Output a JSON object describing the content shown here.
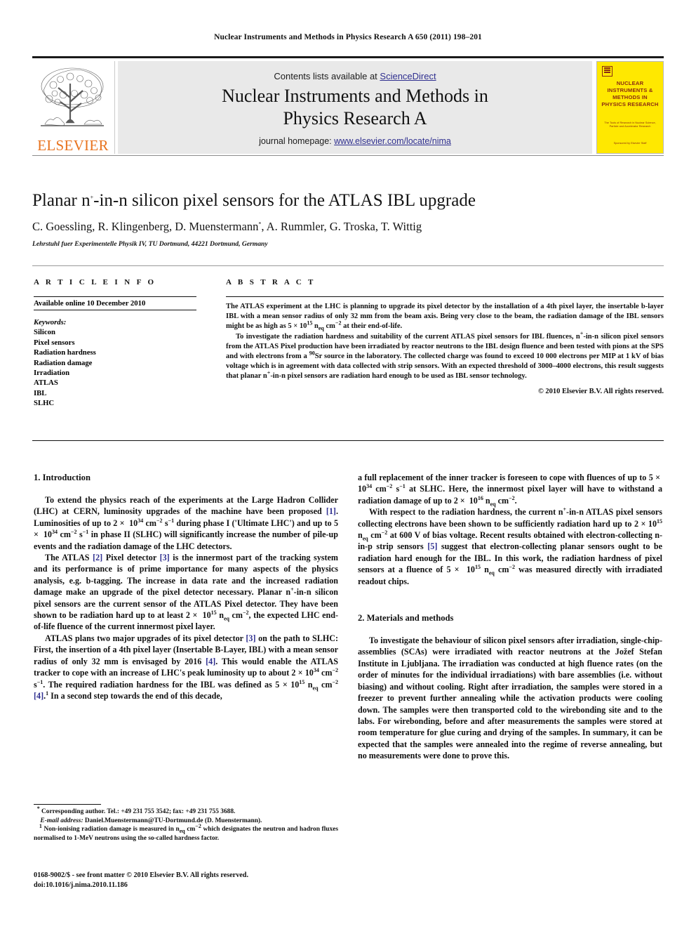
{
  "running_head": "Nuclear Instruments and Methods in Physics Research A 650 (2011) 198–201",
  "masthead": {
    "publisher_name": "ELSEVIER",
    "contents_prefix": "Contents lists available at ",
    "contents_link": "ScienceDirect",
    "journal_title_line1": "Nuclear Instruments and Methods in",
    "journal_title_line2": "Physics Research A",
    "homepage_prefix": "journal homepage: ",
    "homepage_link": "www.elsevier.com/locate/nima",
    "cover": {
      "title": "NUCLEAR INSTRUMENTS & METHODS IN PHYSICS RESEARCH",
      "subtitle": "The Tools of Research in Nuclear Science, Particle and Accelerator Research",
      "footer": "Sponsored by Elsevier Staff"
    },
    "colors": {
      "link": "#2f2f8f",
      "elsevier_orange": "#E8731E",
      "cover_yellow": "#FFE800",
      "cover_text": "#8a2a12",
      "masthead_grey": "#e9e9e9"
    }
  },
  "article": {
    "title": "Planar n+-in-n silicon pixel sensors for the ATLAS IBL upgrade",
    "authors": "C. Goessling, R. Klingenberg, D. Muenstermann *, A. Rummler, G. Troska, T. Wittig",
    "affiliation": "Lehrstuhl fuer Experimentelle Physik IV, TU Dortmund, 44221 Dortmund, Germany"
  },
  "article_info": {
    "heading": "A R T I C L E   I N F O",
    "available_online": "Available online 10 December 2010",
    "keywords_label": "Keywords:",
    "keywords": [
      "Silicon",
      "Pixel sensors",
      "Radiation hardness",
      "Radiation damage",
      "Irradiation",
      "ATLAS",
      "IBL",
      "SLHC"
    ]
  },
  "abstract": {
    "heading": "A B S T R A C T",
    "paragraph1": "The ATLAS experiment at the LHC is planning to upgrade its pixel detector by the installation of a 4th pixel layer, the insertable b-layer IBL with a mean sensor radius of only 32 mm from the beam axis. Being very close to the beam, the radiation damage of the IBL sensors might be as high as 5 × 10^15 neq cm^-2 at their end-of-life.",
    "paragraph2": "To investigate the radiation hardness and suitability of the current ATLAS pixel sensors for IBL fluences, n+-in-n silicon pixel sensors from the ATLAS Pixel production have been irradiated by reactor neutrons to the IBL design fluence and been tested with pions at the SPS and with electrons from a 90Sr source in the laboratory. The collected charge was found to exceed 10 000 electrons per MIP at 1 kV of bias voltage which is in agreement with data collected with strip sensors. With an expected threshold of 3000–4000 electrons, this result suggests that planar n+-in-n pixel sensors are radiation hard enough to be used as IBL sensor technology.",
    "copyright": "© 2010 Elsevier B.V. All rights reserved."
  },
  "sections": {
    "introduction_heading": "1.  Introduction",
    "materials_heading": "2.  Materials and methods"
  },
  "body_left": {
    "p1_a": "To extend the physics reach of the experiments at the Large Hadron Collider (LHC) at CERN, luminosity upgrades of the machine have been proposed ",
    "p1_ref1": "[1]",
    "p1_b": ". Luminosities of up to 2 × 10^34 cm^-2 s^-1 during phase I ('Ultimate LHC') and up to 5 × 10^34 cm^-2 s^-1 in phase II (SLHC) will significantly increase the number of pile-up events and the radiation damage of the LHC detectors.",
    "p2_a": "The ATLAS ",
    "p2_ref1": "[2]",
    "p2_b": " Pixel detector ",
    "p2_ref2": "[3]",
    "p2_c": " is the innermost part of the tracking system and its performance is of prime importance for many aspects of the physics analysis, e.g. b-tagging. The increase in data rate and the increased radiation damage make an upgrade of the pixel detector necessary. Planar n+-in-n silicon pixel sensors are the current sensor of the ATLAS Pixel detector. They have been shown to be radiation hard up to at least 2 × 10^15 neq cm^-2, the expected LHC end-of-life fluence of the current innermost pixel layer.",
    "p3_a": "ATLAS plans two major upgrades of its pixel detector ",
    "p3_ref1": "[3]",
    "p3_b": " on the path to SLHC: First, the insertion of a 4th pixel layer (Insertable B-Layer, IBL) with a mean sensor radius of only 32 mm is envisaged by 2016 ",
    "p3_ref2": "[4]",
    "p3_c": ". This would enable the ATLAS tracker to cope with an increase of LHC's peak luminosity up to about 2 × 10^34 cm^-2 s^-1. The required radiation hardness for the IBL was defined as 5 × 10^15 neq cm^-2 ",
    "p3_ref3": "[4]",
    "p3_d": ".1 In a second step towards the end of this decade,"
  },
  "body_right": {
    "p1": "a full replacement of the inner tracker is foreseen to cope with fluences of up to 5 × 10^34 cm^-2 s^-1 at SLHC. Here, the innermost pixel layer will have to withstand a radiation damage of up to 2 × 10^16 neq cm^-2.",
    "p2_a": "With respect to the radiation hardness, the current n+-in-n ATLAS pixel sensors collecting electrons have been shown to be sufficiently radiation hard up to 2 × 10^15 neq cm^-2 at 600 V of bias voltage. Recent results obtained with electron-collecting n-in-p strip sensors ",
    "p2_ref1": "[5]",
    "p2_b": " suggest that electron-collecting planar sensors ought to be radiation hard enough for the IBL. In this work, the radiation hardness of pixel sensors at a fluence of 5 × 10^15 neq cm^-2 was measured directly with irradiated readout chips.",
    "p3": "To investigate the behaviour of silicon pixel sensors after irradiation, single-chip-assemblies (SCAs) were irradiated with reactor neutrons at the Jožef Stefan Institute in Ljubljana. The irradiation was conducted at high fluence rates (on the order of minutes for the individual irradiations) with bare assemblies (i.e. without biasing) and without cooling. Right after irradiation, the samples were stored in a freezer to prevent further annealing while the activation products were cooling down. The samples were then transported cold to the wirebonding site and to the labs. For wirebonding, before and after measurements the samples were stored at room temperature for glue curing and drying of the samples. In summary, it can be expected that the samples were annealed into the regime of reverse annealing, but no measurements were done to prove this."
  },
  "footnotes": {
    "corresponding": "* Corresponding author. Tel.: +49 231 755 3542; fax: +49 231 755 3688.",
    "email_label": "E-mail address:",
    "email_value": " Daniel.Muenstermann@TU-Dortmund.de (D. Muenstermann).",
    "note1": "1 Non-ionising radiation damage is measured in neq cm^-2 which designates the neutron and hadron fluxes normalised to 1-MeV neutrons using the so-called hardness factor."
  },
  "imprint": {
    "line1": "0168-9002/$ - see front matter © 2010 Elsevier B.V. All rights reserved.",
    "line2": "doi:10.1016/j.nima.2010.11.186"
  }
}
